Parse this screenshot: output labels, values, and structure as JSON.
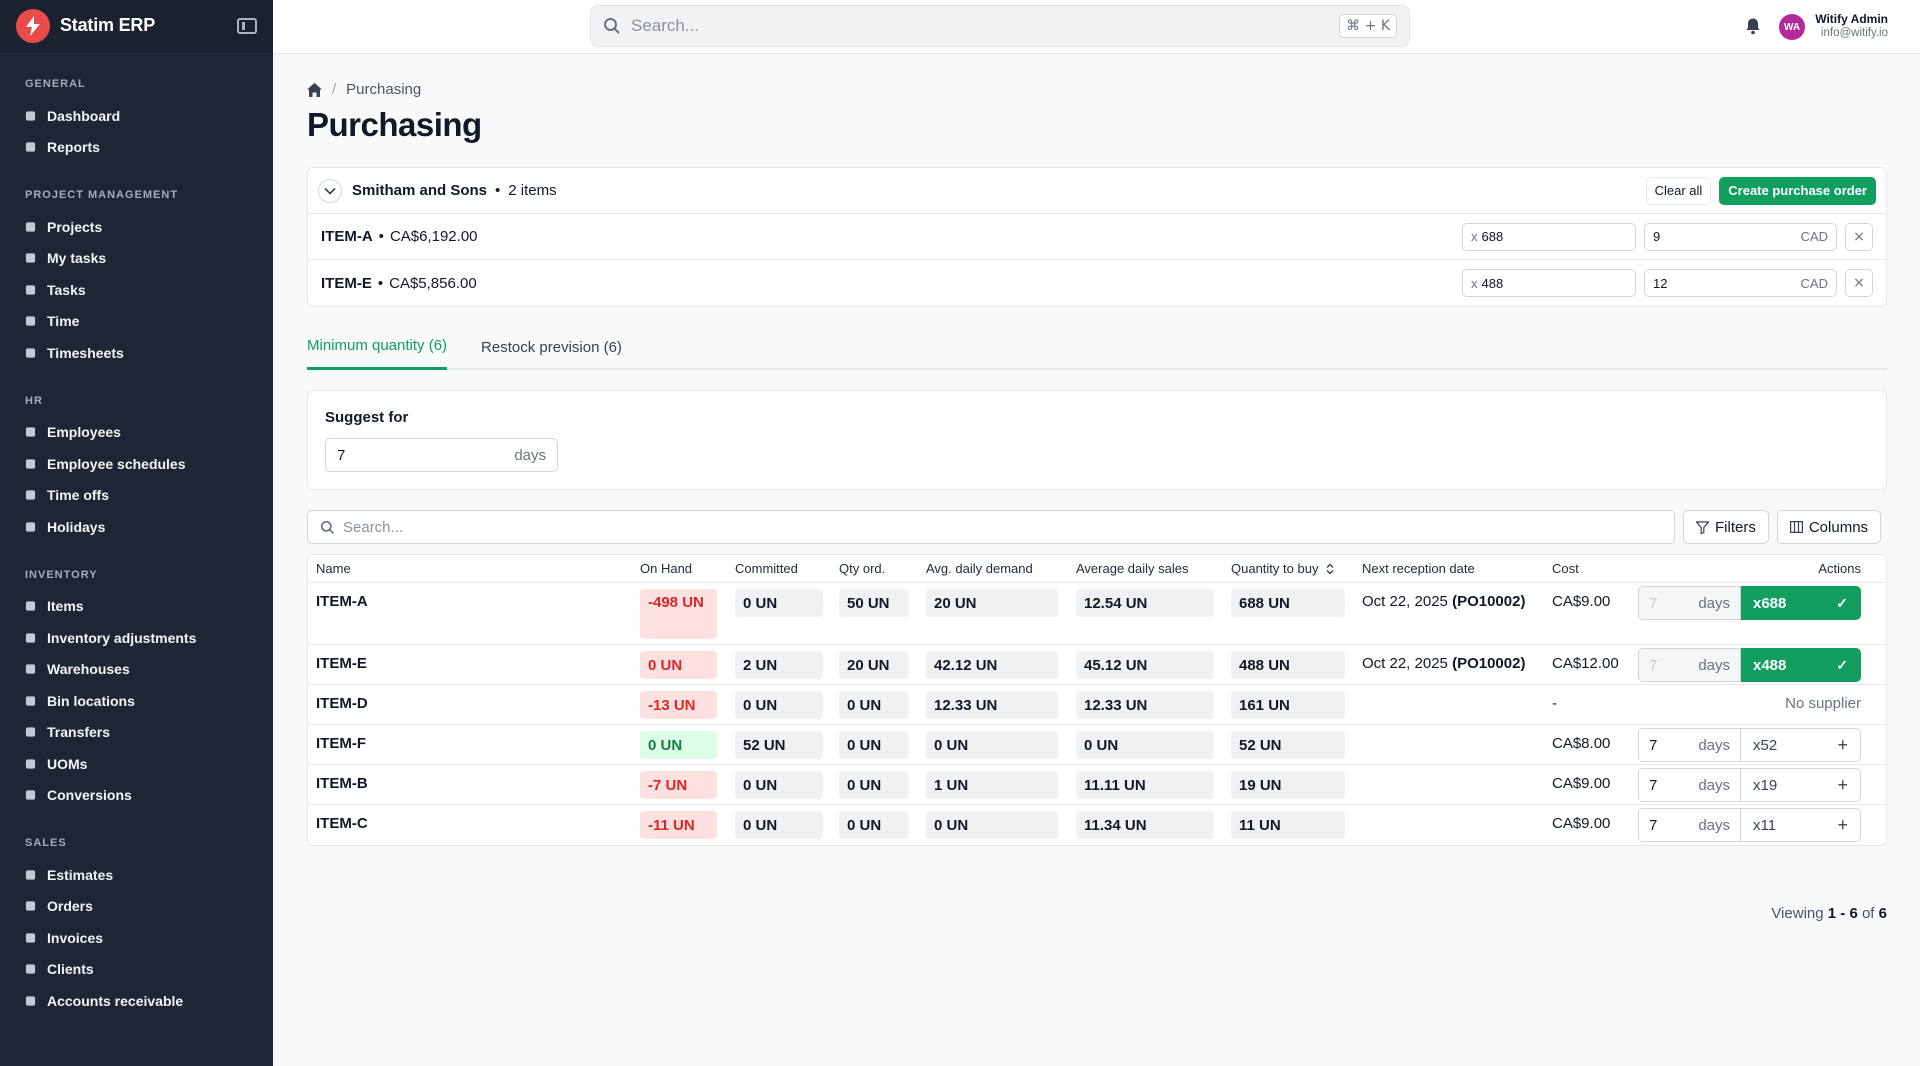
{
  "app": {
    "name": "Statim ERP"
  },
  "sidebar": {
    "sections": [
      {
        "title": "GENERAL",
        "items": [
          "Dashboard",
          "Reports"
        ]
      },
      {
        "title": "PROJECT MANAGEMENT",
        "items": [
          "Projects",
          "My tasks",
          "Tasks",
          "Time",
          "Timesheets"
        ]
      },
      {
        "title": "HR",
        "items": [
          "Employees",
          "Employee schedules",
          "Time offs",
          "Holidays"
        ]
      },
      {
        "title": "INVENTORY",
        "items": [
          "Items",
          "Inventory adjustments",
          "Warehouses",
          "Bin locations",
          "Transfers",
          "UOMs",
          "Conversions"
        ]
      },
      {
        "title": "SALES",
        "items": [
          "Estimates",
          "Orders",
          "Invoices",
          "Clients",
          "Accounts receivable"
        ]
      }
    ]
  },
  "topbar": {
    "search_placeholder": "Search...",
    "shortcut": "⌘ + K",
    "user": {
      "initials": "WA",
      "name": "Witify Admin",
      "email": "info@witify.io"
    }
  },
  "breadcrumb": {
    "current": "Purchasing"
  },
  "page_title": "Purchasing",
  "supplier": {
    "name": "Smitham and Sons",
    "separator": "•",
    "count_label": "2 items",
    "clear_label": "Clear all",
    "create_label": "Create purchase order",
    "lines": [
      {
        "code": "ITEM-A",
        "separator": "•",
        "amount": "CA$6,192.00",
        "qty_prefix": "x",
        "qty": "688",
        "price": "9",
        "currency": "CAD"
      },
      {
        "code": "ITEM-E",
        "separator": "•",
        "amount": "CA$5,856.00",
        "qty_prefix": "x",
        "qty": "488",
        "price": "12",
        "currency": "CAD"
      }
    ]
  },
  "tabs": [
    {
      "label": "Minimum quantity (6)",
      "active": true
    },
    {
      "label": "Restock prevision (6)",
      "active": false
    }
  ],
  "suggest": {
    "label": "Suggest for",
    "value": "7",
    "unit": "days"
  },
  "table_toolbar": {
    "search_placeholder": "Search...",
    "filters_label": "Filters",
    "columns_label": "Columns"
  },
  "table": {
    "headers": {
      "name": "Name",
      "on_hand": "On Hand",
      "committed": "Committed",
      "qty_ord": "Qty ord.",
      "avg_demand": "Avg. daily demand",
      "avg_sales": "Average daily sales",
      "to_buy": "Quantity to buy",
      "next_reception": "Next reception date",
      "cost": "Cost",
      "actions": "Actions"
    },
    "rows": [
      {
        "name": "ITEM-A",
        "on_hand": "-498 UN",
        "on_hand_status": "negative",
        "committed": "0 UN",
        "qty_ord": "50 UN",
        "avg_demand": "20 UN",
        "avg_sales": "12.54 UN",
        "to_buy": "688 UN",
        "reception_date": "Oct 22, 2025",
        "reception_po": "(PO10002)",
        "cost": "CA$9.00",
        "days": "7",
        "days_unit": "days",
        "action_qty": "x688",
        "in_order": true,
        "no_supplier": ""
      },
      {
        "name": "ITEM-E",
        "on_hand": "0 UN",
        "on_hand_status": "negative",
        "committed": "2 UN",
        "qty_ord": "20 UN",
        "avg_demand": "42.12 UN",
        "avg_sales": "45.12 UN",
        "to_buy": "488 UN",
        "reception_date": "Oct 22, 2025",
        "reception_po": "(PO10002)",
        "cost": "CA$12.00",
        "days": "7",
        "days_unit": "days",
        "action_qty": "x488",
        "in_order": true,
        "no_supplier": ""
      },
      {
        "name": "ITEM-D",
        "on_hand": "-13 UN",
        "on_hand_status": "negative",
        "committed": "0 UN",
        "qty_ord": "0 UN",
        "avg_demand": "12.33 UN",
        "avg_sales": "12.33 UN",
        "to_buy": "161 UN",
        "reception_date": "",
        "reception_po": "",
        "cost": "-",
        "days": "",
        "days_unit": "",
        "action_qty": "",
        "in_order": false,
        "no_supplier": "No supplier"
      },
      {
        "name": "ITEM-F",
        "on_hand": "0 UN",
        "on_hand_status": "positive",
        "committed": "52 UN",
        "qty_ord": "0 UN",
        "avg_demand": "0 UN",
        "avg_sales": "0 UN",
        "to_buy": "52 UN",
        "reception_date": "",
        "reception_po": "",
        "cost": "CA$8.00",
        "days": "7",
        "days_unit": "days",
        "action_qty": "x52",
        "in_order": false,
        "no_supplier": ""
      },
      {
        "name": "ITEM-B",
        "on_hand": "-7 UN",
        "on_hand_status": "negative",
        "committed": "0 UN",
        "qty_ord": "0 UN",
        "avg_demand": "1 UN",
        "avg_sales": "11.11 UN",
        "to_buy": "19 UN",
        "reception_date": "",
        "reception_po": "",
        "cost": "CA$9.00",
        "days": "7",
        "days_unit": "days",
        "action_qty": "x19",
        "in_order": false,
        "no_supplier": ""
      },
      {
        "name": "ITEM-C",
        "on_hand": "-11 UN",
        "on_hand_status": "negative",
        "committed": "0 UN",
        "qty_ord": "0 UN",
        "avg_demand": "0 UN",
        "avg_sales": "11.34 UN",
        "to_buy": "11 UN",
        "reception_date": "",
        "reception_po": "",
        "cost": "CA$9.00",
        "days": "7",
        "days_unit": "days",
        "action_qty": "x11",
        "in_order": false,
        "no_supplier": ""
      }
    ]
  },
  "pagination": {
    "prefix": "Viewing",
    "from": "1",
    "dash": "-",
    "to": "6",
    "of": "of",
    "total": "6"
  },
  "colors": {
    "accent": "#119e5f",
    "sidebar": "#1d2634",
    "danger": "#dc2626",
    "logo": "#e94b4b"
  }
}
